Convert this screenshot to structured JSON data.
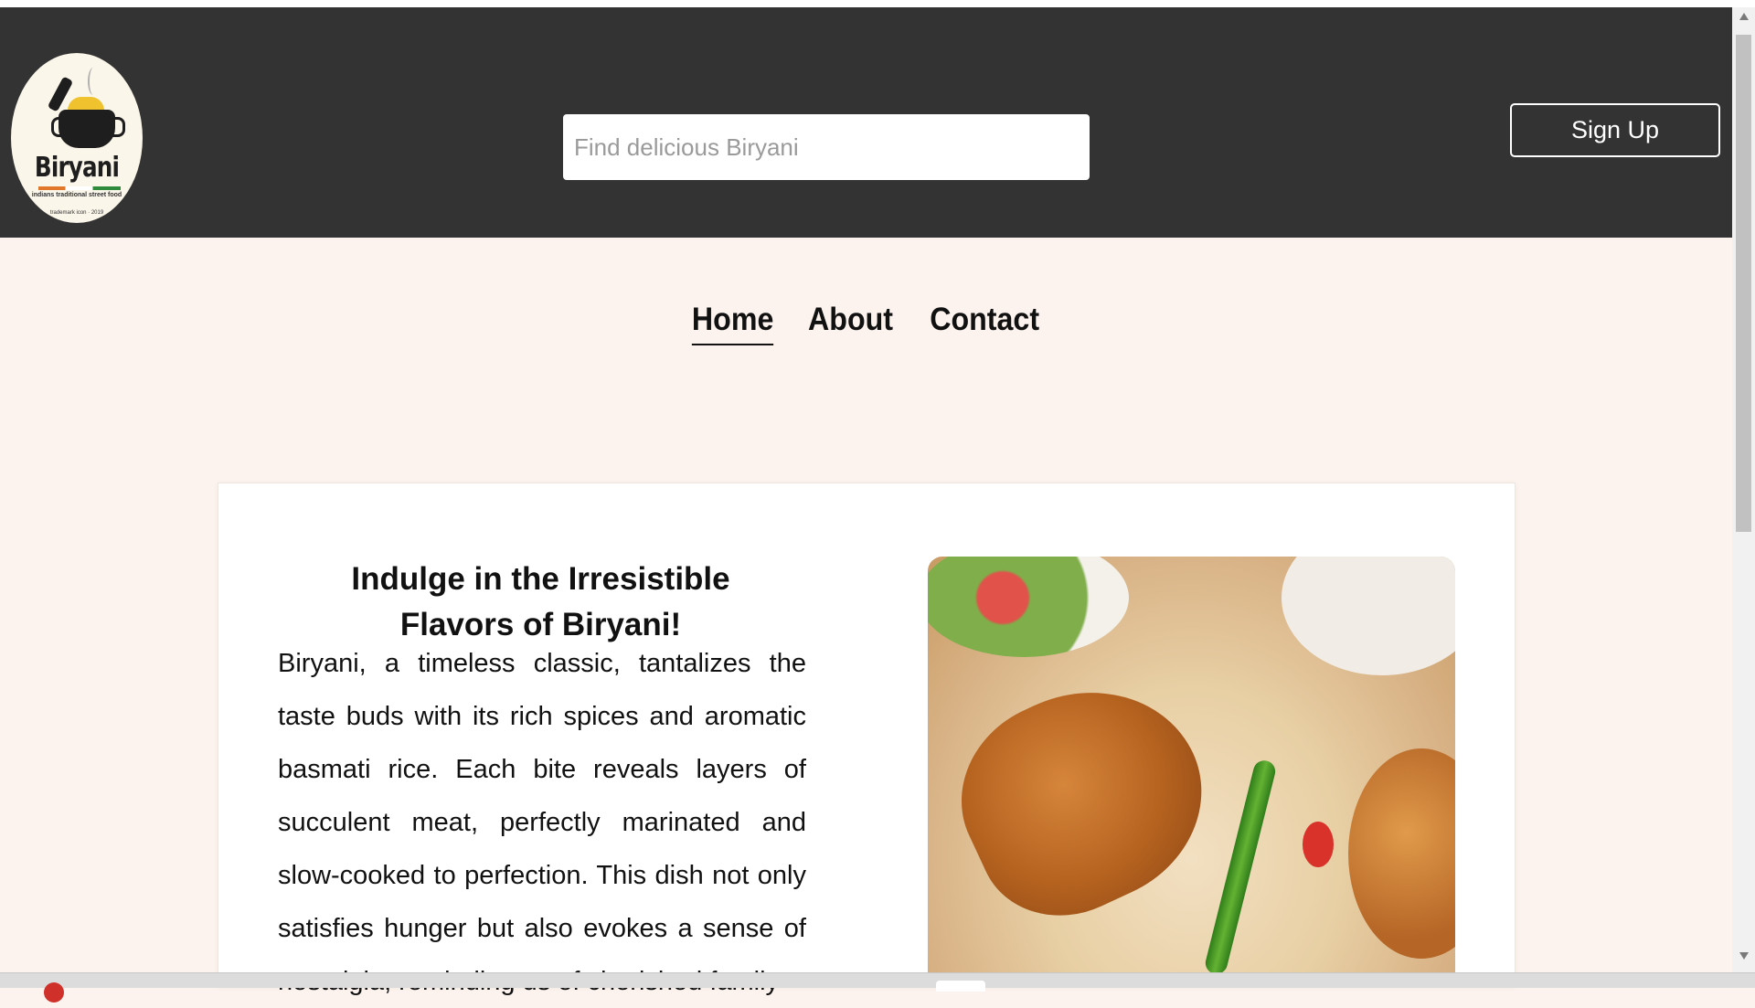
{
  "header": {
    "logo": {
      "brand": "Biryani",
      "tagline": "indians traditional street food",
      "trademark": "trademark icon · 2019"
    },
    "search": {
      "placeholder": "Find delicious Biryani",
      "value": ""
    },
    "signup_label": "Sign Up"
  },
  "nav": {
    "items": [
      {
        "label": "Home",
        "active": true
      },
      {
        "label": "About",
        "active": false
      },
      {
        "label": "Contact",
        "active": false
      }
    ]
  },
  "content": {
    "heading": "Indulge in the Irresistible Flavors of Biryani!",
    "body": "Biryani, a timeless classic, tantalizes the taste buds with its rich spices and aromatic basmati rice. Each bite reveals layers of succulent meat, perfectly marinated and slow-cooked to perfection. This dish not only satisfies hunger but also evokes a sense of nostalgia, reminding us of cherished family",
    "image_subject": "chicken-biryani-photo"
  },
  "colors": {
    "header_bg": "#333333",
    "page_bg": "#fdf3ee",
    "card_bg": "#ffffff",
    "text": "#111111"
  }
}
